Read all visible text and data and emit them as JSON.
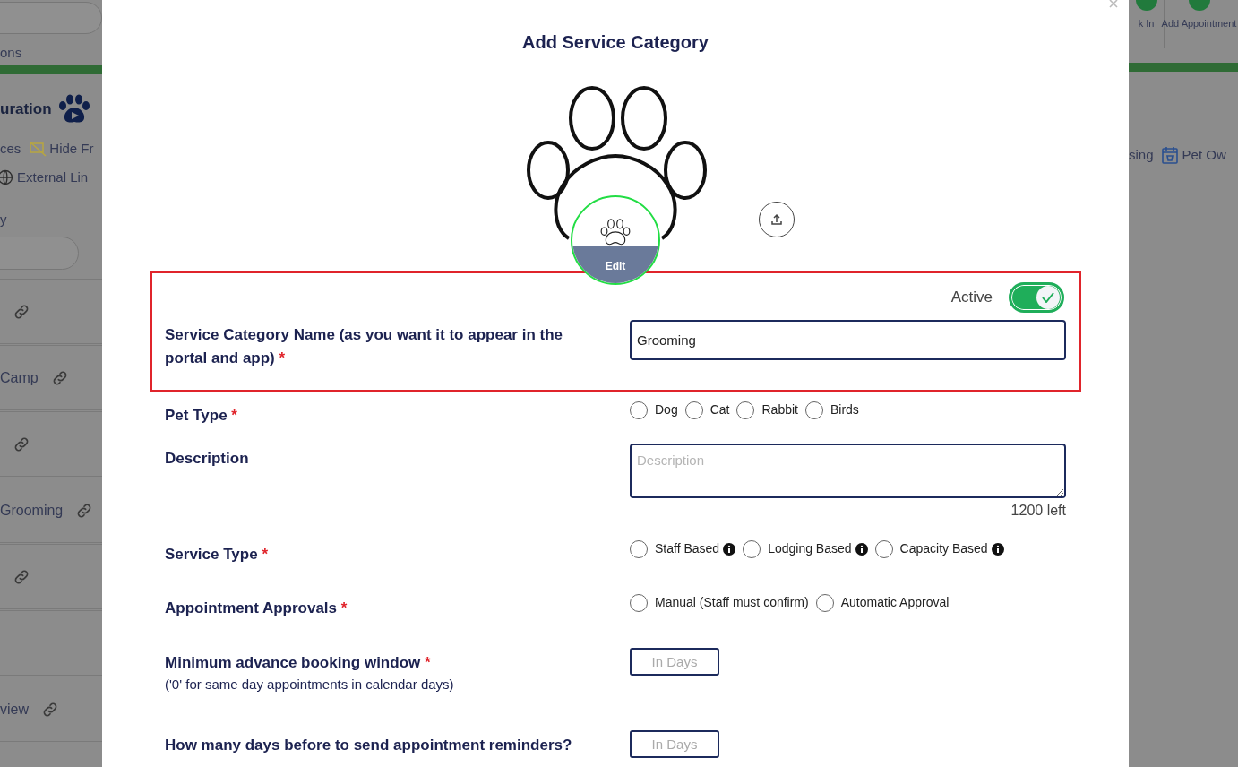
{
  "background_page": {
    "left": {
      "tab_fragment": "ons",
      "heading": "uration",
      "link_rows": [
        [
          {
            "kind": "text",
            "label": "ces"
          },
          {
            "kind": "hide",
            "label": "Hide Fr"
          }
        ],
        [
          {
            "kind": "globe",
            "label": "External Lin"
          }
        ]
      ],
      "section_label": "y",
      "list_rows": [
        {
          "label": ""
        },
        {
          "label": "Camp"
        },
        {
          "label": ""
        },
        {
          "label": "Grooming"
        },
        {
          "label": ""
        },
        {
          "label": null
        },
        {
          "label": "view"
        }
      ]
    },
    "right": {
      "toolbar": [
        {
          "label": "k In"
        },
        {
          "label": "Add Appointment"
        }
      ],
      "links": [
        {
          "kind": "text",
          "label": "sing"
        },
        {
          "kind": "calendar",
          "label": "Pet Ow"
        }
      ]
    }
  },
  "modal": {
    "title": "Add Service Category",
    "edit_label": "Edit",
    "active": {
      "label": "Active",
      "on": true
    },
    "fields": [
      {
        "kind": "text",
        "label": "Service Category Name (as you want it to appear in the portal and app)",
        "required_mark": "*",
        "value": "Grooming",
        "highlighted": true
      },
      {
        "kind": "radios",
        "label": "Pet Type",
        "required_mark": "*",
        "highlighted": false,
        "options": [
          {
            "label": "Dog",
            "selected": false
          },
          {
            "label": "Cat",
            "selected": false
          },
          {
            "label": "Rabbit",
            "selected": false
          },
          {
            "label": "Birds",
            "selected": false
          }
        ]
      },
      {
        "kind": "textarea",
        "label": "Description",
        "highlighted": false,
        "placeholder": "Description",
        "counter": "1200 left"
      },
      {
        "kind": "radios",
        "label": "Service Type",
        "required_mark": "*",
        "highlighted": false,
        "options": [
          {
            "label": "Staff Based",
            "selected": false,
            "info": true
          },
          {
            "label": "Lodging Based",
            "selected": false,
            "info": true
          },
          {
            "label": "Capacity Based",
            "selected": false,
            "info": true
          }
        ]
      },
      {
        "kind": "radios",
        "label": "Appointment Approvals",
        "required_mark": "*",
        "highlighted": false,
        "options": [
          {
            "label": "Manual (Staff must confirm)",
            "selected": false
          },
          {
            "label": "Automatic Approval",
            "selected": false
          }
        ]
      },
      {
        "kind": "number",
        "label": "Minimum advance booking window",
        "required_mark": "*",
        "highlighted": false,
        "hint": "('0' for same day appointments in calendar days)",
        "placeholder": "In Days"
      },
      {
        "kind": "number",
        "label": "How many days before to send appointment reminders?",
        "highlighted": false,
        "placeholder": "In Days"
      }
    ]
  }
}
